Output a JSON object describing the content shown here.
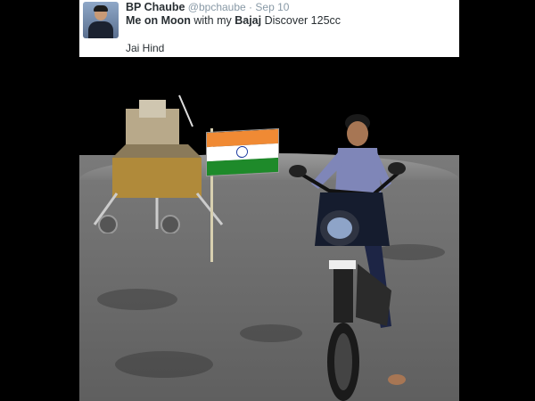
{
  "tweet": {
    "name": "BP Chaube",
    "handle": "@bpchaube",
    "separator": "·",
    "date": "Sep 10",
    "text_bold_1": "Me on Moon",
    "text_plain_1": " with my ",
    "text_bold_2": "Bajaj",
    "text_plain_2": " Discover 125cc",
    "text_line_2": "Jai Hind"
  },
  "colors": {
    "saffron": "#f08a34",
    "green": "#1e8a2a",
    "chakra": "#1b3aa0"
  }
}
